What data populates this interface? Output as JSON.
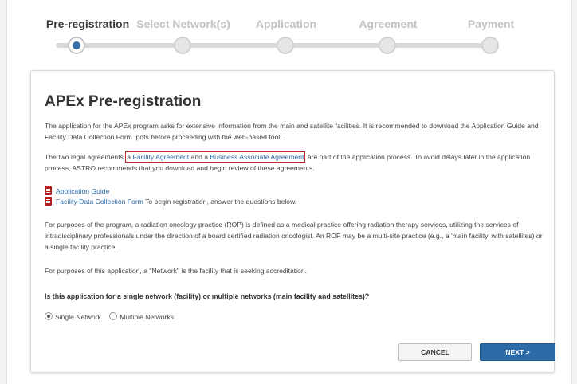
{
  "steps": [
    {
      "label": "Pre-registration",
      "active": true
    },
    {
      "label": "Select Network(s)",
      "active": false
    },
    {
      "label": "Application",
      "active": false
    },
    {
      "label": "Agreement",
      "active": false
    },
    {
      "label": "Payment",
      "active": false
    }
  ],
  "card": {
    "title": "APEx Pre-registration",
    "intro": "The application for the APEx program asks for extensive information from the main and satellite facilities. It is recommended to download the Application Guide and Facility Data Collection Form .pdfs before proceeding with the web-based tool.",
    "agreements": {
      "before": "The two legal agreements ",
      "highlight_prefix": "a ",
      "link1": "Facility Agreement",
      "middle": " and a ",
      "link2": "Business Associate Agreement",
      "after": " are part of the application process. To avoid delays later in the application process, ASTRO recommends that you download and begin review of these agreements."
    },
    "downloads": {
      "guide_link": "Application Guide",
      "form_link": "Facility Data Collection Form",
      "form_suffix": " To begin registration, answer the questions below."
    },
    "rop_definition": "For purposes of the program, a radiation oncology practice (ROP) is defined as a medical practice offering radiation therapy services, utilizing the services of intradisciplinary professionals under the direction of a board certified radiation oncologist. An ROP may be a multi-site practice (e.g., a 'main facility' with satellites) or a single facility practice.",
    "network_definition": "For purposes of this application, a \"Network\" is the facility that is seeking accreditation.",
    "question": "Is this application for a single network (facility) or multiple networks (main facility and satellites)?",
    "options": {
      "single": "Single Network",
      "multiple": "Multiple Networks",
      "selected": "single"
    },
    "buttons": {
      "cancel": "CANCEL",
      "next": "NEXT >"
    }
  },
  "colors": {
    "accent": "#2c6aa7",
    "link": "#2b6aa8",
    "highlight_border": "#c22a2a",
    "pdf_icon": "#b41e1e"
  }
}
